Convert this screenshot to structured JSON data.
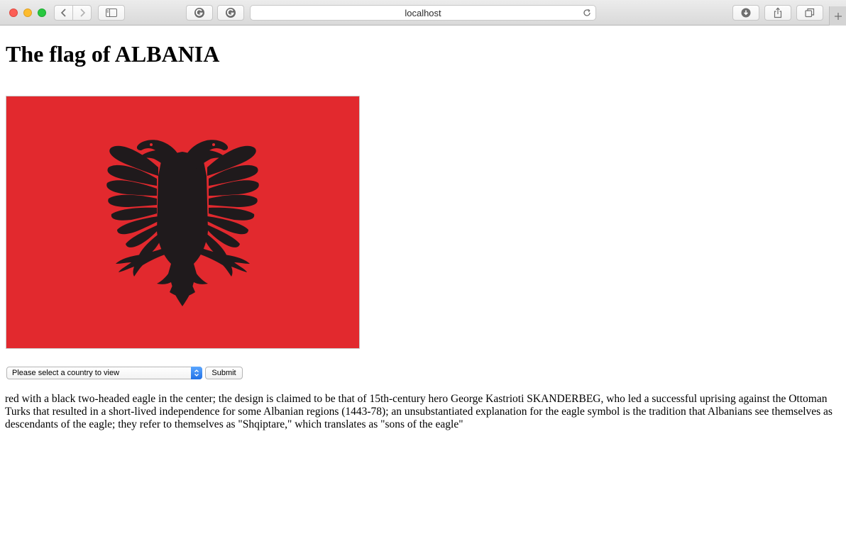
{
  "browser": {
    "address": "localhost",
    "icons": {
      "back": "chevron-left-icon",
      "forward": "chevron-right-icon",
      "sidebar": "sidebar-icon",
      "extension1": "grammarly-icon",
      "extension2": "grammarly-icon",
      "reload": "reload-icon",
      "downloads": "download-icon",
      "share": "share-icon",
      "tabs": "tabs-icon",
      "new_tab": "plus-icon"
    }
  },
  "page": {
    "title": "The flag of ALBANIA",
    "flag": {
      "country": "ALBANIA",
      "field_color": "#e2292e",
      "emblem_color": "#1f1a1c"
    },
    "form": {
      "select_value": "Please select a country to view",
      "submit_label": "Submit"
    },
    "description": "red with a black two-headed eagle in the center; the design is claimed to be that of 15th-century hero George Kastrioti SKANDERBEG, who led a successful uprising against the Ottoman Turks that resulted in a short-lived independence for some Albanian regions (1443-78); an unsubstantiated explanation for the eagle symbol is the tradition that Albanians see themselves as descendants of the eagle; they refer to themselves as \"Shqiptare,\" which translates as \"sons of the eagle\""
  }
}
